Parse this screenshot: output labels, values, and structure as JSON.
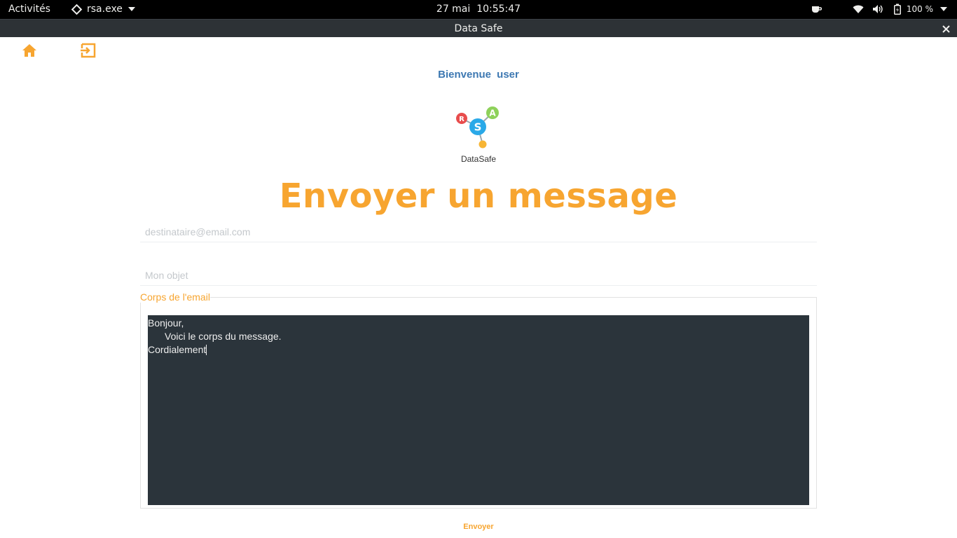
{
  "topbar": {
    "activities": "Activités",
    "app_name": "rsa.exe",
    "date": "27 mai",
    "time": "10:55:47",
    "battery": "100 %"
  },
  "window": {
    "title": "Data Safe"
  },
  "toolbar": {
    "home_icon": "home-icon",
    "logout_icon": "logout-icon",
    "accent_color": "#f7a530"
  },
  "welcome": {
    "greeting": "Bienvenue",
    "username": "user"
  },
  "logo": {
    "label": "DataSafe",
    "letters": {
      "r": "R",
      "s": "S",
      "a": "A"
    }
  },
  "form": {
    "heading": "Envoyer un message",
    "recipient_placeholder": "destinataire@email.com",
    "subject_placeholder": "Mon objet",
    "body_legend": "Corps de l'email",
    "body_lines": [
      "Bonjour,",
      "Voici le corps du message.",
      "Cordialement"
    ],
    "send_label": "Envoyer"
  }
}
